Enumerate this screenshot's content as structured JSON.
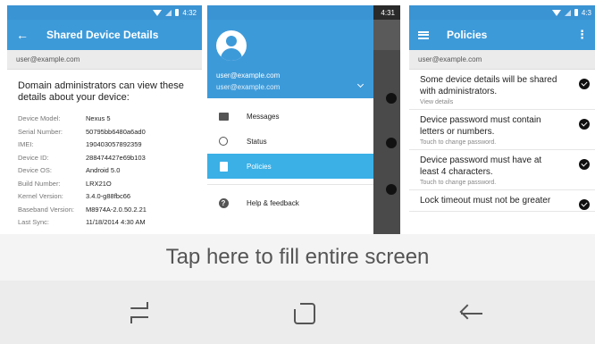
{
  "screen1": {
    "status_time": "4:32",
    "title": "Shared Device Details",
    "account": "user@example.com",
    "heading": "Domain administrators can view these details about your device:",
    "details": [
      {
        "label": "Device Model:",
        "value": "Nexus 5"
      },
      {
        "label": "Serial Number:",
        "value": "50795bb6480a6ad0"
      },
      {
        "label": "IMEI:",
        "value": "190403057892359"
      },
      {
        "label": "Device ID:",
        "value": "288474427e69b103"
      },
      {
        "label": "Device OS:",
        "value": "Android 5.0"
      },
      {
        "label": "Build Number:",
        "value": "LRX21O"
      },
      {
        "label": "Kernel Version:",
        "value": "3.4.0-g88fbc66"
      },
      {
        "label": "Baseband Version:",
        "value": "M8974A-2.0.50.2.21"
      },
      {
        "label": "Last Sync:",
        "value": "11/18/2014 4:30 AM"
      }
    ]
  },
  "screen2": {
    "status_time": "4:31",
    "email_primary": "user@example.com",
    "email_secondary": "user@example.com",
    "menu": [
      {
        "label": "Messages",
        "icon": "messages-icon"
      },
      {
        "label": "Status",
        "icon": "status-icon"
      },
      {
        "label": "Policies",
        "icon": "policies-icon",
        "active": true
      },
      {
        "label": "Help & feedback",
        "icon": "help-icon"
      }
    ]
  },
  "screen3": {
    "status_time": "4:3",
    "title": "Policies",
    "account": "user@example.com",
    "policies": [
      {
        "title": "Some device details will be shared with administrators.",
        "subtitle": "View details"
      },
      {
        "title": "Device password must contain letters or numbers.",
        "subtitle": "Touch to change password."
      },
      {
        "title": "Device password must have at least 4 characters.",
        "subtitle": "Touch to change password."
      },
      {
        "title": "Lock timeout must not be greater",
        "subtitle": ""
      }
    ]
  },
  "overlay": {
    "fill_text": "Tap here to fill entire screen"
  },
  "colors": {
    "appbar": "#3d9ad9",
    "statusbar": "#3a93d3",
    "active_item": "#3ab0e6"
  }
}
